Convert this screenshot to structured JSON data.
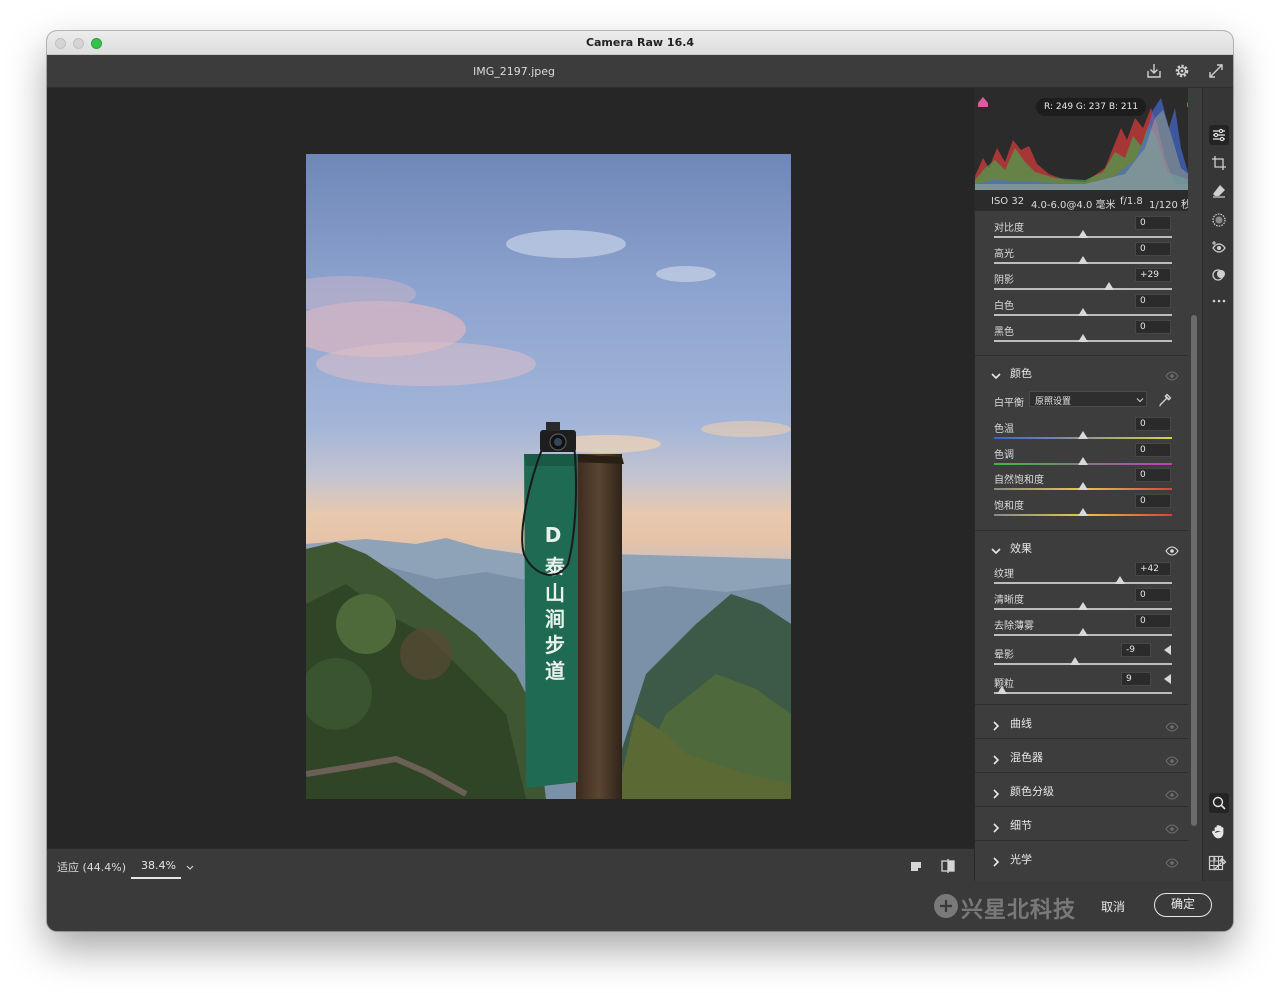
{
  "app": {
    "title": "Camera Raw 16.4",
    "file_name": "IMG_2197.jpeg"
  },
  "histogram": {
    "rgb_readout": "R: 249   G: 237   B: 211"
  },
  "exif": {
    "iso": "ISO 32",
    "lens": "4.0-6.0@4.0 毫米",
    "aperture": "f/1.8",
    "shutter": "1/120 秒"
  },
  "basic_rows": [
    {
      "label": "对比度",
      "value": "0",
      "position": 0.5
    },
    {
      "label": "高光",
      "value": "0",
      "position": 0.5
    },
    {
      "label": "阴影",
      "value": "+29",
      "position": 0.645
    },
    {
      "label": "白色",
      "value": "0",
      "position": 0.5
    },
    {
      "label": "黑色",
      "value": "0",
      "position": 0.5
    }
  ],
  "color_section": {
    "title": "颜色",
    "white_balance_label": "白平衡",
    "white_balance_value": "原照设置",
    "rows": [
      {
        "label": "色温",
        "value": "0",
        "position": 0.5
      },
      {
        "label": "色调",
        "value": "0",
        "position": 0.5
      },
      {
        "label": "自然饱和度",
        "value": "0",
        "position": 0.5
      },
      {
        "label": "饱和度",
        "value": "0",
        "position": 0.5
      }
    ]
  },
  "effects_section": {
    "title": "效果",
    "rows": [
      {
        "label": "纹理",
        "value": "+42",
        "position": 0.71
      },
      {
        "label": "清晰度",
        "value": "0",
        "position": 0.5
      },
      {
        "label": "去除薄雾",
        "value": "0",
        "position": 0.5
      },
      {
        "label": "晕影",
        "value": "-9",
        "position": 0.455
      },
      {
        "label": "颗粒",
        "value": "9",
        "position": 0.045
      }
    ]
  },
  "collapsed_sections": [
    {
      "title": "曲线"
    },
    {
      "title": "混色器"
    },
    {
      "title": "颜色分级"
    },
    {
      "title": "细节"
    },
    {
      "title": "光学"
    }
  ],
  "zoom": {
    "fit_label": "适应 (44.4%)",
    "current": "38.4%"
  },
  "footer": {
    "watermark": "兴星北科技",
    "cancel_label": "取消",
    "ok_label": "确定"
  },
  "photo": {
    "sign_text": "D泰山涧步道"
  },
  "colors": {
    "panel_bg": "#3d3d3d",
    "canvas_bg": "#262626",
    "temp_gradient": [
      "#3f5fd9",
      "#d8d24a"
    ],
    "tint_gradient": [
      "#3dbb3d",
      "#c03dbd"
    ],
    "vibrance_gradient": [
      "#8a8a8a",
      "#e4c94a",
      "#d9423b"
    ],
    "saturation_gradient": [
      "#8a8a8a",
      "#e4c94a",
      "#d9423b"
    ]
  }
}
